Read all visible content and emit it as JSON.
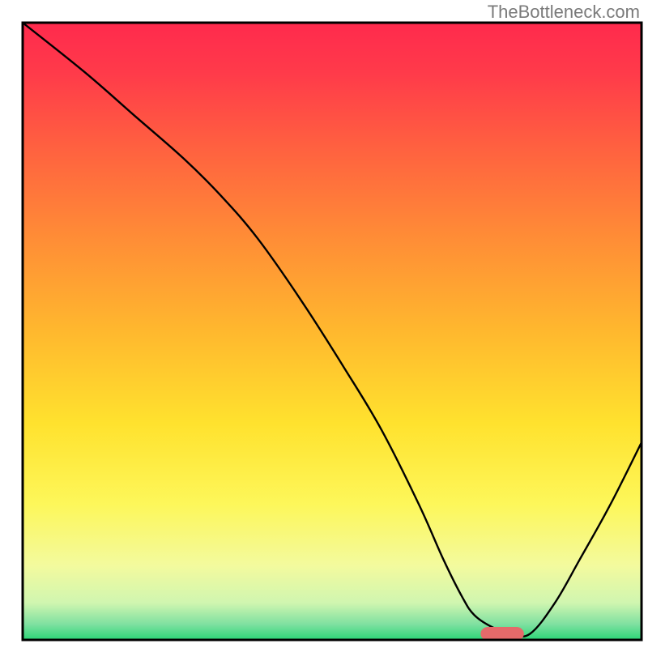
{
  "watermark": "TheBottleneck.com",
  "chart_data": {
    "type": "line",
    "title": "",
    "xlabel": "",
    "ylabel": "",
    "xlim": [
      0,
      100
    ],
    "ylim": [
      0,
      100
    ],
    "background_gradient": {
      "stops": [
        {
          "offset": 0,
          "color": "#ff2a4d"
        },
        {
          "offset": 0.08,
          "color": "#ff3a4a"
        },
        {
          "offset": 0.2,
          "color": "#ff6040"
        },
        {
          "offset": 0.35,
          "color": "#ff8d36"
        },
        {
          "offset": 0.5,
          "color": "#ffb82e"
        },
        {
          "offset": 0.65,
          "color": "#ffe22e"
        },
        {
          "offset": 0.78,
          "color": "#fdf75a"
        },
        {
          "offset": 0.88,
          "color": "#f3fa9e"
        },
        {
          "offset": 0.94,
          "color": "#d0f6b0"
        },
        {
          "offset": 0.975,
          "color": "#7ee0a0"
        },
        {
          "offset": 1.0,
          "color": "#2bd676"
        }
      ]
    },
    "series": [
      {
        "name": "bottleneck-curve",
        "stroke": "#000000",
        "stroke_width": 2.4,
        "x": [
          0,
          10,
          18,
          26,
          32,
          38,
          45,
          52,
          58,
          64,
          68,
          71,
          73,
          76,
          79,
          82,
          86,
          90,
          95,
          100
        ],
        "y": [
          100,
          92,
          85,
          78,
          72,
          65,
          55,
          44,
          34,
          22,
          13,
          7,
          4,
          2,
          1,
          1,
          6,
          13,
          22,
          32
        ]
      }
    ],
    "marker": {
      "name": "optimal-range",
      "x_center": 77.5,
      "y": 1,
      "width": 7,
      "height": 2.2,
      "color": "#e46a6a",
      "rx": 1.2
    },
    "frame": {
      "stroke": "#000000",
      "stroke_width": 3
    }
  }
}
